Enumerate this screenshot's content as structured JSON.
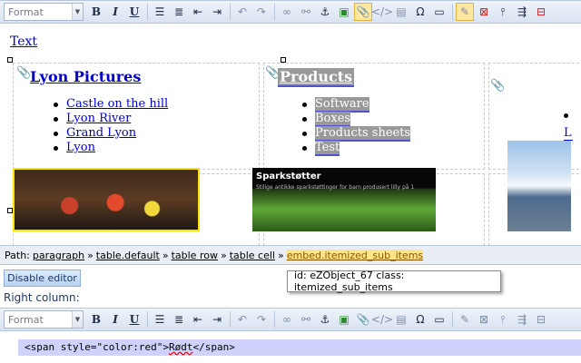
{
  "toolbar1": {
    "format_label": "Format",
    "buttons": [
      {
        "name": "bold-button",
        "glyph": "B"
      },
      {
        "name": "italic-button",
        "glyph": "I"
      },
      {
        "name": "underline-button",
        "glyph": "U"
      }
    ]
  },
  "editor": {
    "top_link": "Text",
    "cells": [
      {
        "heading": "Lyon Pictures",
        "items": [
          "Castle on the hill",
          "Lyon River",
          "Grand Lyon",
          "Lyon"
        ]
      },
      {
        "heading": "Products",
        "items": [
          "Software",
          "Boxes",
          "Products sheets",
          "Test"
        ]
      }
    ],
    "image2_title": "Sparkstøtter",
    "image2_sub": "Stilige antikke sparkstøttinger for barn produsert lilly på 1"
  },
  "path": {
    "label": "Path:",
    "crumbs": [
      "paragraph",
      "table.default",
      "table row",
      "table cell",
      "embed.itemized_sub_items"
    ],
    "separator": "»"
  },
  "tooltip": "id: eZObject_67 class: itemized_sub_items",
  "disable_button": "Disable editor",
  "right_column_label": "Right column:",
  "toolbar2": {
    "format_label": "Format"
  },
  "code": {
    "pre": "<span style=\"color:red\">",
    "word": "Rødt",
    "post": "</span>"
  }
}
